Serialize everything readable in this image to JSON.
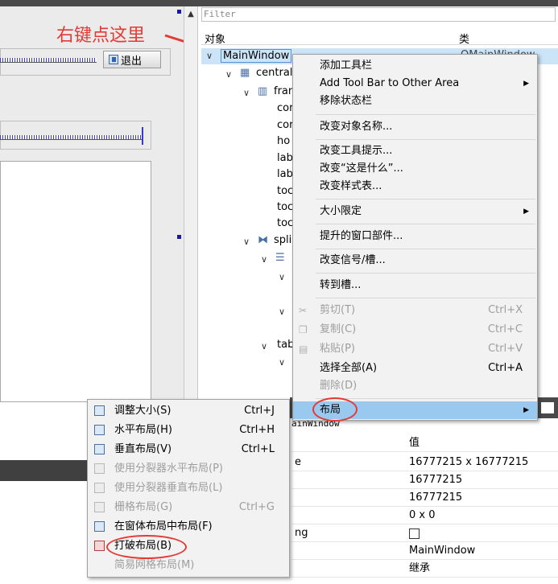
{
  "annotation": {
    "text": "右键点这里",
    "color": "#e53935"
  },
  "designer": {
    "exit_button": "退出"
  },
  "filter": {
    "placeholder": "Filter"
  },
  "object_inspector": {
    "header_object": "对象",
    "header_class": "类",
    "tree": [
      {
        "label": "MainWindow",
        "class": "QMainWindow"
      },
      {
        "label": "central"
      },
      {
        "label": "fran"
      },
      {
        "label": "cor"
      },
      {
        "label": "cor"
      },
      {
        "label": "ho"
      },
      {
        "label": "lab"
      },
      {
        "label": "lab"
      },
      {
        "label": "toc"
      },
      {
        "label": "toc"
      },
      {
        "label": "toc"
      },
      {
        "label": "spli"
      },
      {
        "label": "tab"
      }
    ]
  },
  "context_menu": {
    "items": [
      {
        "label": "添加工具栏"
      },
      {
        "label": "Add Tool Bar to Other Area"
      },
      {
        "label": "移除状态栏"
      },
      {
        "label": "改变对象名称..."
      },
      {
        "label": "改变工具提示..."
      },
      {
        "label": "改变“这是什么”..."
      },
      {
        "label": "改变样式表..."
      },
      {
        "label": "大小限定"
      },
      {
        "label": "提升的窗口部件..."
      },
      {
        "label": "改变信号/槽..."
      },
      {
        "label": "转到槽..."
      },
      {
        "label": "剪切(T)",
        "shortcut": "Ctrl+X"
      },
      {
        "label": "复制(C)",
        "shortcut": "Ctrl+C"
      },
      {
        "label": "粘贴(P)",
        "shortcut": "Ctrl+V"
      },
      {
        "label": "选择全部(A)",
        "shortcut": "Ctrl+A"
      },
      {
        "label": "删除(D)"
      },
      {
        "label": "布局"
      }
    ]
  },
  "layout_submenu": {
    "items": [
      {
        "label": "调整大小(S)",
        "shortcut": "Ctrl+J"
      },
      {
        "label": "水平布局(H)",
        "shortcut": "Ctrl+H"
      },
      {
        "label": "垂直布局(V)",
        "shortcut": "Ctrl+L"
      },
      {
        "label": "使用分裂器水平布局(P)"
      },
      {
        "label": "使用分裂器垂直布局(L)"
      },
      {
        "label": "栅格布局(G)",
        "shortcut": "Ctrl+G"
      },
      {
        "label": "在窗体布局中布局(F)"
      },
      {
        "label": "打破布局(B)"
      },
      {
        "label": "简易网格布局(M)"
      }
    ]
  },
  "property_editor": {
    "title_fragment": "ainWindow",
    "header_value": "值",
    "name_fragment": "ng",
    "rows": [
      {
        "name": "e",
        "value": "16777215 x 16777215"
      },
      {
        "value": "16777215"
      },
      {
        "value": "16777215"
      },
      {
        "value": "0 x 0"
      },
      {
        "value": ""
      },
      {
        "value": "MainWindow"
      },
      {
        "value": "继承"
      }
    ]
  }
}
